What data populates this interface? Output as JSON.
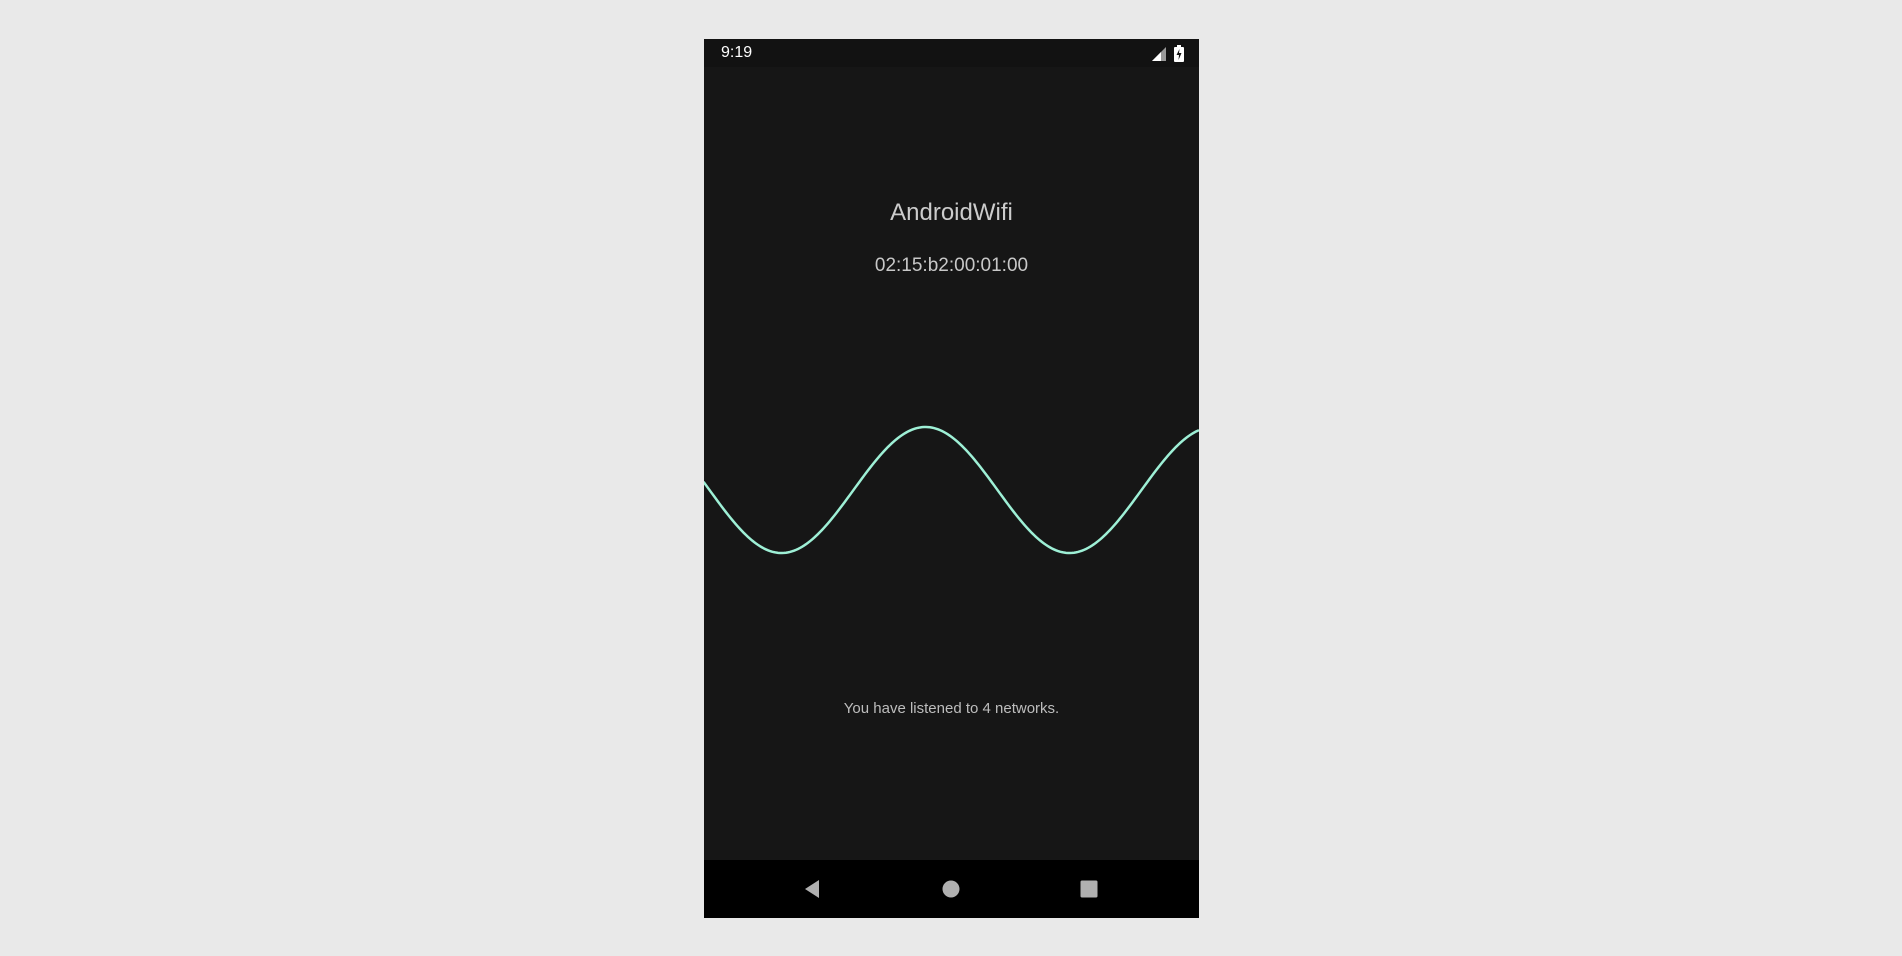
{
  "status_bar": {
    "time": "9:19",
    "icons": [
      "signal-icon",
      "battery-charging-icon"
    ]
  },
  "app": {
    "title": "AndroidWifi",
    "mac_address": "02:15:b2:00:01:00",
    "networks_message": "You have listened to 4 networks."
  },
  "wave": {
    "color": "#9ef0d6",
    "amplitude": 1,
    "cycles": 1.75
  },
  "nav_bar": {
    "buttons": [
      "back-icon",
      "home-icon",
      "recents-icon"
    ]
  },
  "colors": {
    "screen_bg": "#161616",
    "page_bg": "#e9e9e9",
    "accent": "#9ef0d6"
  }
}
